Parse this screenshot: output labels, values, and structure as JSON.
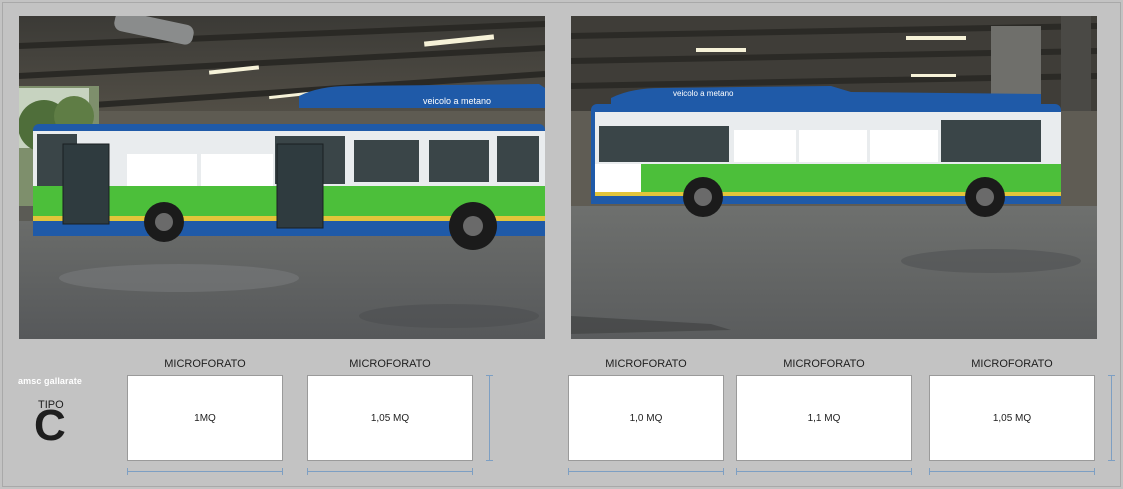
{
  "brand": {
    "name": "amsc gallarate"
  },
  "type": {
    "label": "TIPO",
    "letter": "C"
  },
  "photos": {
    "left": {
      "bus_text": "veicolo a metano"
    },
    "right": {
      "bus_text": "veicolo a metano"
    }
  },
  "panels": [
    {
      "title": "MICROFORATO",
      "value": "1MQ"
    },
    {
      "title": "MICROFORATO",
      "value": "1,05 MQ"
    },
    {
      "title": "MICROFORATO",
      "value": "1,0 MQ"
    },
    {
      "title": "MICROFORATO",
      "value": "1,1 MQ"
    },
    {
      "title": "MICROFORATO",
      "value": "1,05 MQ"
    }
  ],
  "colors": {
    "background": "#c3c3c3",
    "bus_blue": "#1f5aa8",
    "bus_green": "#4cbf3a",
    "dimension_line": "#7d9fc3"
  }
}
